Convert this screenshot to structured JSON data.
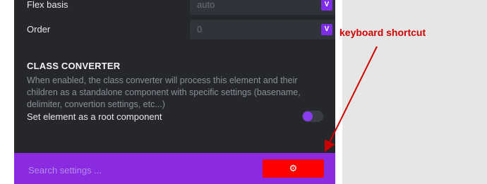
{
  "rows": [
    {
      "label": "Flex basis",
      "value": "auto",
      "button": "V"
    },
    {
      "label": "Order",
      "value": "0",
      "button": "V"
    }
  ],
  "class_converter": {
    "title": "CLASS CONVERTER",
    "description": "When enabled, the class converter will process this element and their children as a standalone component with specific settings (basename, delimiter, convertion settings, etc...)",
    "toggle_label": "Set element as a root component"
  },
  "footer": {
    "search_placeholder": "Search settings ...",
    "gear_icon": "⚙"
  },
  "annotation": {
    "text": "keyboard shortcut",
    "color": "#d10000"
  },
  "colors": {
    "panel": "#25272b",
    "accent": "#8a2be2",
    "highlight": "#ff0000"
  }
}
